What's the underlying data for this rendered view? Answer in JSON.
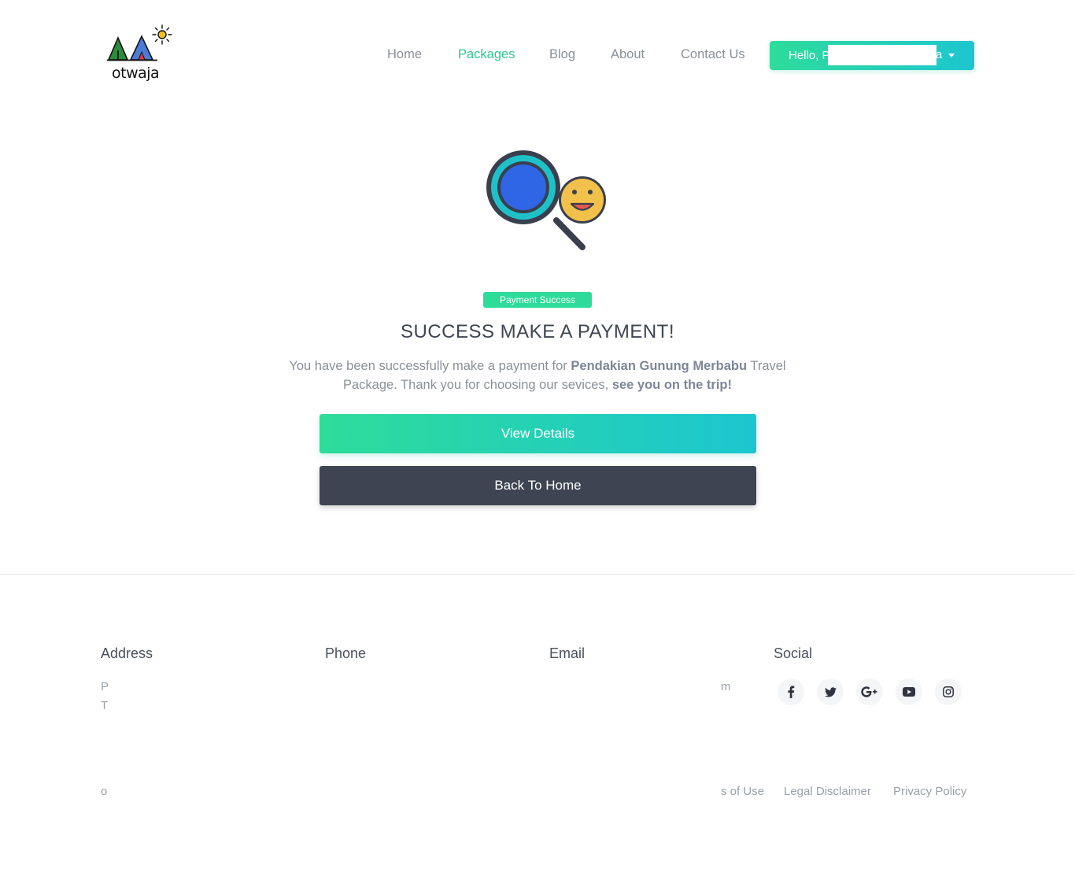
{
  "brand": {
    "logo_text": "otwaja"
  },
  "nav": {
    "home": "Home",
    "packages": "Packages",
    "blog": "Blog",
    "about": "About",
    "contact": "Contact Us",
    "active": "Packages",
    "user_greeting": "Hello, P",
    "user_tail": "a"
  },
  "hero": {
    "badge": "Payment Success",
    "title": "SUCCESS MAKE A PAYMENT!",
    "message_part1": "You have been successfully make a payment for ",
    "package_name": "Pendakian Gunung Merbabu",
    "message_part2": " Travel Package. Thank you for choosing our sevices, ",
    "message_emphasis": "see you on the trip!",
    "view_details": "View Details",
    "back_home": "Back To Home"
  },
  "footer": {
    "address_heading": "Address",
    "phone_heading": "Phone",
    "email_heading": "Email",
    "social_heading": "Social",
    "address_frag1": "P",
    "address_frag2": "T",
    "email_frag1": "m",
    "social_icons": [
      "facebook-icon",
      "twitter-icon",
      "google-plus-icon",
      "youtube-icon",
      "instagram-icon"
    ],
    "copyright_frag": "o",
    "terms_frag": "s of Use",
    "legal": "Legal Disclaimer",
    "privacy": "Privacy Policy"
  },
  "colors": {
    "accent_green": "#2edc9a",
    "accent_cyan": "#1cc6d0",
    "dark_button": "#3e4452",
    "muted_text": "#8a8f99"
  }
}
